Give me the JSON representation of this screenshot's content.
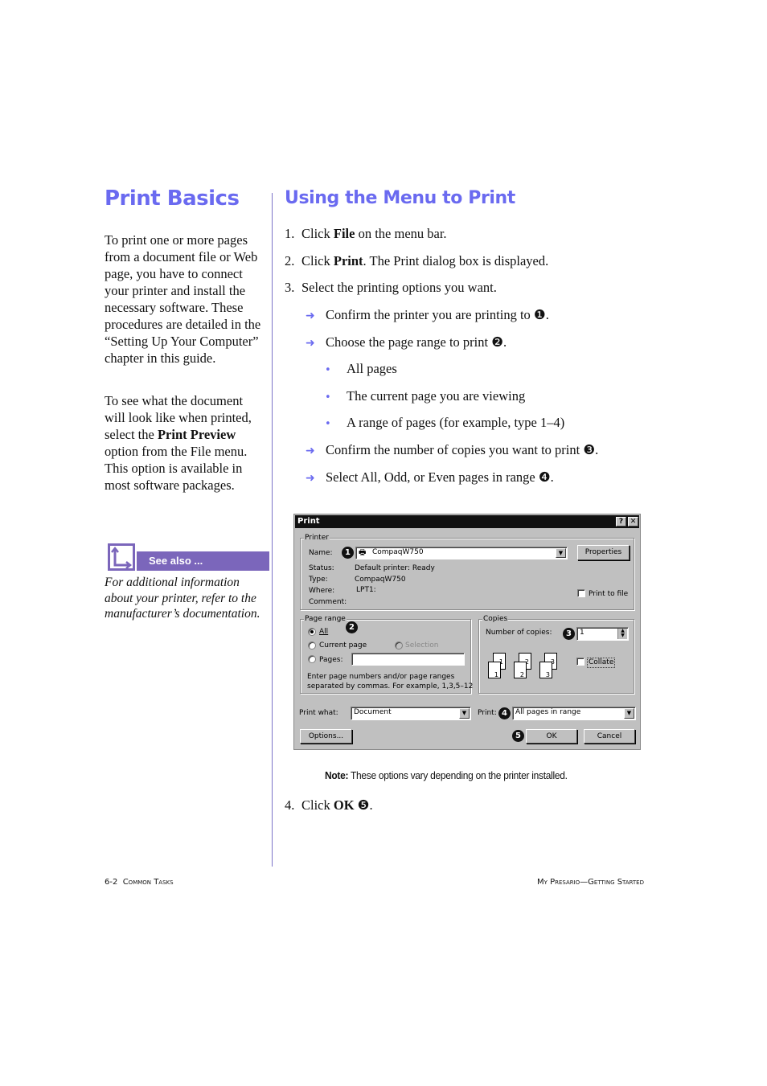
{
  "left": {
    "title": "Print Basics",
    "paragraph1": "To print one or more pages from a document file or Web page, you have to connect your printer and install the necessary software. These procedures are detailed in the “Setting Up Your Computer” chapter in this guide.",
    "paragraph2_pre": "To see what the document will look like when printed, select the ",
    "paragraph2_bold": "Print Preview",
    "paragraph2_post": " option from the File menu. This option is available in most software packages.",
    "see_also": {
      "icon": "corner-arrow-icon",
      "label": "See also ...",
      "text": "For additional information about your printer, refer to the manufacturer’s documentation."
    }
  },
  "right": {
    "title": "Using the Menu to Print",
    "steps": [
      {
        "num": "1.",
        "pre": "Click ",
        "bold": "File",
        "post": " on the menu bar."
      },
      {
        "num": "2.",
        "pre": "Click ",
        "bold": "Print",
        "post": ". The Print dialog box is displayed."
      },
      {
        "num": "3.",
        "pre": "Select the printing options you want.",
        "bold": "",
        "post": ""
      },
      {
        "num": "4.",
        "pre": "Click ",
        "bold": "OK",
        "post": " ❺."
      }
    ],
    "arrow_items": [
      "Confirm the printer you are printing to ❶.",
      "Choose the page range to print ❷.",
      "Confirm the number of copies you want to print ❸.",
      "Select All, Odd, or Even pages in range ❹."
    ],
    "bullets": [
      "All pages",
      "The current page you are viewing",
      "A range of pages (for example, type 1–4)"
    ],
    "note_label": "Note:",
    "note_text": " These options vary depending on the printer installed."
  },
  "dialog": {
    "title": "Print",
    "help_btn": "?",
    "close_btn": "✕",
    "printer_group": "Printer",
    "name_label": "Name:",
    "name_value": "CompaqW750",
    "properties_btn": "Properties",
    "status_label": "Status:",
    "status_value": "Default printer: Ready",
    "type_label": "Type:",
    "type_value": "CompaqW750",
    "where_label": "Where:",
    "where_value": "LPT1:",
    "comment_label": "Comment:",
    "print_to_file": "Print to file",
    "page_range_group": "Page range",
    "radio_all": "All",
    "radio_current": "Current page",
    "radio_selection": "Selection",
    "radio_pages": "Pages:",
    "pages_value": "",
    "range_hint_1": "Enter page numbers and/or page ranges",
    "range_hint_2": "separated by commas.  For example, 1,3,5–12",
    "copies_group": "Copies",
    "copies_label": "Number of copies:",
    "copies_value": "1",
    "collate": "Collate",
    "collate_pages": [
      "1",
      "2",
      "3"
    ],
    "print_what_label": "Print what:",
    "print_what_value": "Document",
    "print_label": "Print:",
    "print_value": "All pages in range",
    "options_btn": "Options...",
    "ok_btn": "OK",
    "cancel_btn": "Cancel",
    "markers": [
      "1",
      "2",
      "3",
      "4",
      "5"
    ]
  },
  "footer": {
    "left_page": "6-2",
    "left_section": "Common Tasks",
    "right_title": "My Presario—Getting Started"
  },
  "colors": {
    "heading": "#6a6af0",
    "accent_purple": "#7b66bb",
    "dialog_gray": "#c0c0c0"
  }
}
